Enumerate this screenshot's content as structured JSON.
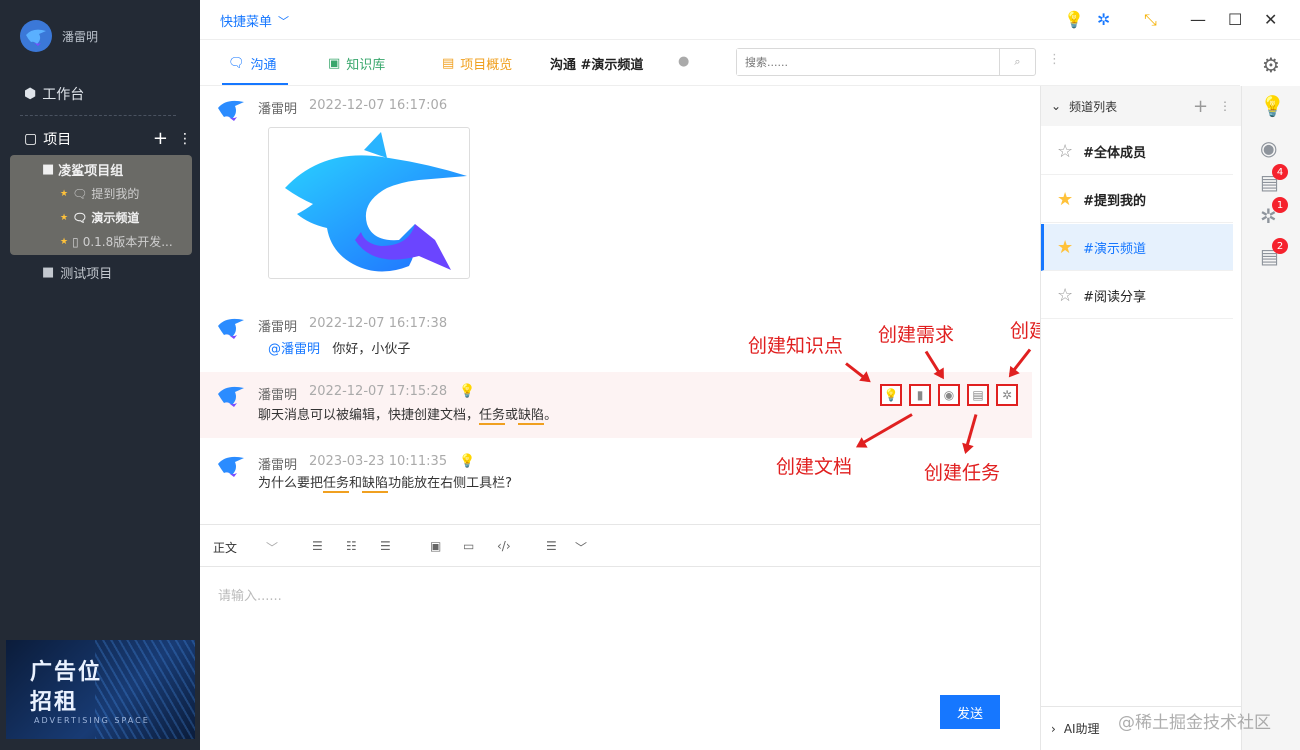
{
  "sidebar": {
    "user_name": "潘雷明",
    "workbench": "工作台",
    "project_header": "项目",
    "group": {
      "name": "凌鲨项目组",
      "items": [
        "提到我的",
        "演示频道",
        "0.1.8版本开发..."
      ]
    },
    "test_project": "测试项目",
    "ad": {
      "line1": "广告位",
      "line2": "招租",
      "line3": "ADVERTISING SPACE"
    }
  },
  "topbar": {
    "quick_menu": "快捷菜单"
  },
  "tabs": {
    "items": [
      "沟通",
      "知识库",
      "项目概览"
    ],
    "channel_title": "沟通  #演示频道",
    "search_placeholder": "搜索......"
  },
  "messages": [
    {
      "author": "潘雷明",
      "time": "2022-12-07 16:17:06"
    },
    {
      "author": "潘雷明",
      "time": "2022-12-07 16:17:38",
      "mention": "@潘雷明",
      "text": "你好，小伙子"
    },
    {
      "author": "潘雷明",
      "time": "2022-12-07 17:15:28",
      "text_parts": [
        "聊天消息可以被编辑，快捷创建文档，",
        "任务",
        "或",
        "缺陷",
        "。"
      ]
    },
    {
      "author": "潘雷明",
      "time": "2023-03-23 10:11:35",
      "text_parts": [
        "为什么要把",
        "任务",
        "和",
        "缺陷",
        "功能放在右侧工具栏?"
      ]
    }
  ],
  "annotations": {
    "knowledge": "创建知识点",
    "requirement": "创建需求",
    "bug": "创建缺陷",
    "doc": "创建文档",
    "task": "创建任务"
  },
  "editor": {
    "style_select": "正文",
    "placeholder": "请输入......",
    "send_label": "发送"
  },
  "channels": {
    "header": "频道列表",
    "items": [
      "#全体成员",
      "#提到我的",
      "#演示频道",
      "#阅读分享"
    ],
    "ai_assistant": "AI助理"
  },
  "badges": {
    "requirement": "4",
    "bug": "1",
    "task": "2"
  },
  "watermark": "@稀土掘金技术社区",
  "colors": {
    "accent": "#1677ff",
    "annotation": "#e02020",
    "star": "#ffc23a"
  }
}
